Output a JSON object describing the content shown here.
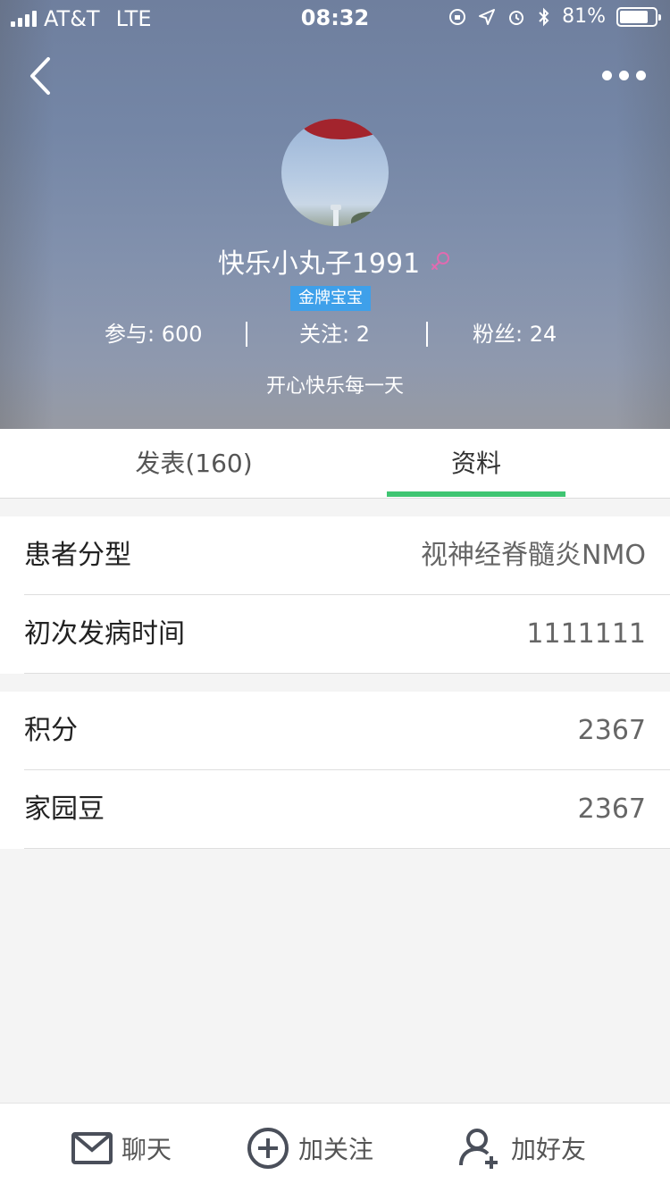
{
  "status_bar": {
    "carrier": "AT&T",
    "network": "LTE",
    "time": "08:32",
    "battery": "81%",
    "battery_level": 0.81
  },
  "profile": {
    "nickname": "快乐小丸子1991",
    "gender_icon": "female-icon",
    "badge": "金牌宝宝",
    "stats": {
      "participate": "参与: 600",
      "following": "关注: 2",
      "fans": "粉丝: 24"
    },
    "signature": "开心快乐每一天"
  },
  "tabs": {
    "posts": "发表(160)",
    "profile": "资料",
    "active": "profile"
  },
  "info_section_1": [
    {
      "label": "患者分型",
      "value": "视神经脊髓炎NMO"
    },
    {
      "label": "初次发病时间",
      "value": "1111111"
    }
  ],
  "info_section_2": [
    {
      "label": "积分",
      "value": "2367"
    },
    {
      "label": "家园豆",
      "value": "2367"
    }
  ],
  "bottom_bar": {
    "chat": "聊天",
    "follow": "加关注",
    "add_friend": "加好友"
  },
  "colors": {
    "accent_green": "#3fc572",
    "badge_blue": "#3ea0ea",
    "female_pink": "#e06bb0"
  }
}
